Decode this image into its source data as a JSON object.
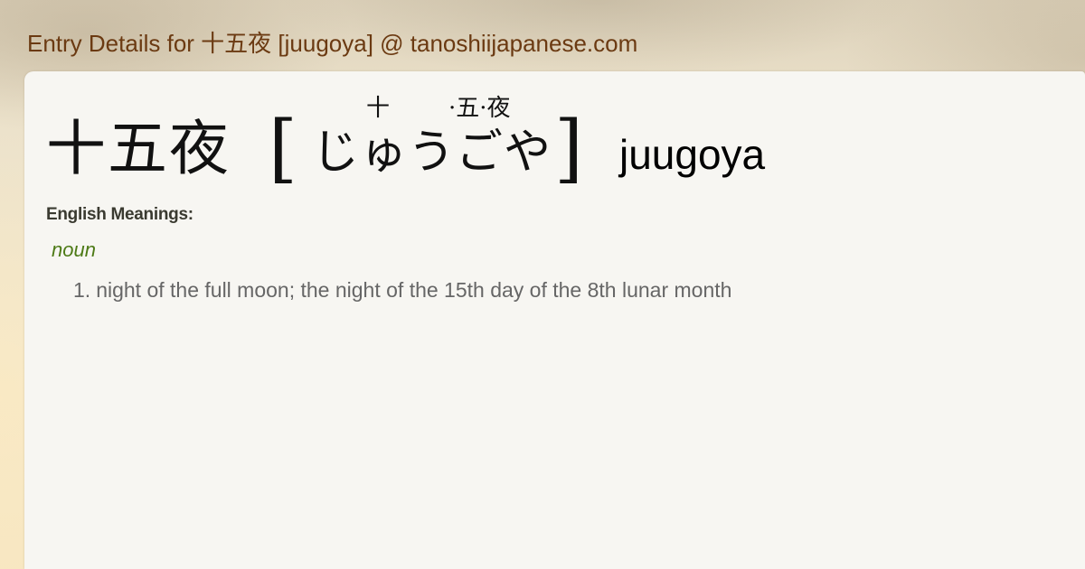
{
  "site_title": "Entry Details for 十五夜 [juugoya] @ tanoshiijapanese.com",
  "entry": {
    "kanji": "十五夜",
    "bracket_open": "[",
    "bracket_close": "]",
    "furigana": {
      "first": "十",
      "second": "·五·夜"
    },
    "reading": "じゅうごや",
    "romaji": "juugoya"
  },
  "meanings": {
    "label": "English Meanings:",
    "part_of_speech": "noun",
    "definitions": [
      {
        "number": "1.",
        "text": "night of the full moon; the night of the 15th day of the 8th lunar month"
      }
    ]
  },
  "colors": {
    "title": "#6b3a12",
    "part_of_speech": "#4d7a16",
    "definition": "#666666",
    "panel": "#f7f6f2"
  }
}
